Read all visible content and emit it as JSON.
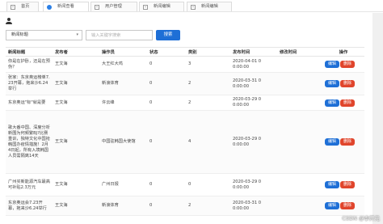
{
  "tabs": [
    {
      "label": "首页",
      "active": false,
      "icon": "file-icon"
    },
    {
      "label": "新闻查看",
      "active": true,
      "icon": "dot-icon"
    },
    {
      "label": "用户管理",
      "active": false,
      "icon": "file-icon"
    },
    {
      "label": "新闻编辑",
      "active": false,
      "icon": "file-icon"
    },
    {
      "label": "新闻编辑",
      "active": false,
      "icon": "file-icon"
    }
  ],
  "toolbar": {
    "select_value": "新闻标题",
    "search_placeholder": "输入关键字搜索",
    "search_label": "搜索"
  },
  "table": {
    "columns": [
      "新闻标题",
      "发布者",
      "操作员",
      "状态",
      "类别",
      "发布时间",
      "修改时间",
      "操作"
    ],
    "rows": [
      {
        "title": "你是在护卧，还是在预伪？",
        "publisher": "王文海",
        "operator": "大王红大鸡",
        "status": "0",
        "category": "3",
        "publish_time": "2020-04-01 0 0:00:00",
        "modify_time": ""
      },
      {
        "title": "张家：东京奥运榜单7.23开幕，拖来沙6.24举行",
        "publisher": "王文海",
        "operator": "新浪体育",
        "status": "0",
        "category": "2",
        "publish_time": "2020-03-31 0 0:00:00",
        "modify_time": ""
      },
      {
        "title": "东京奥运\"标\"就是要",
        "publisher": "王文海",
        "operator": "许云峰",
        "status": "0",
        "category": "2",
        "publish_time": "2020-03-29 0 0:00:00",
        "modify_time": ""
      },
      {
        "title": "歌大番中国、深度分析新围为何频繁BJ?比赛重训，独特文化中国抢韩国办疫情措施！2月4日起，所有入境韩国人员需隔离14天",
        "publisher": "王文海",
        "operator": "中国驻韩国大使馆",
        "status": "0",
        "category": "4",
        "publish_time": "2020-03-29 0 0:00:00",
        "modify_time": ""
      },
      {
        "title": "广州买新能源汽车最高可补贴2.3万元",
        "publisher": "王文海",
        "operator": "广州日报",
        "status": "0",
        "category": "0",
        "publish_time": "2020-03-29 0 0:00:00",
        "modify_time": ""
      },
      {
        "title": "东京奥运会7.23开幕，拖来沙6.24举行",
        "publisher": "王文海",
        "operator": "新浪体育",
        "status": "0",
        "category": "2",
        "publish_time": "2020-03-31 0 0:00:00",
        "modify_time": ""
      }
    ],
    "edit_label": "编辑",
    "delete_label": "删除"
  },
  "watermark": "CSDN @李开元"
}
